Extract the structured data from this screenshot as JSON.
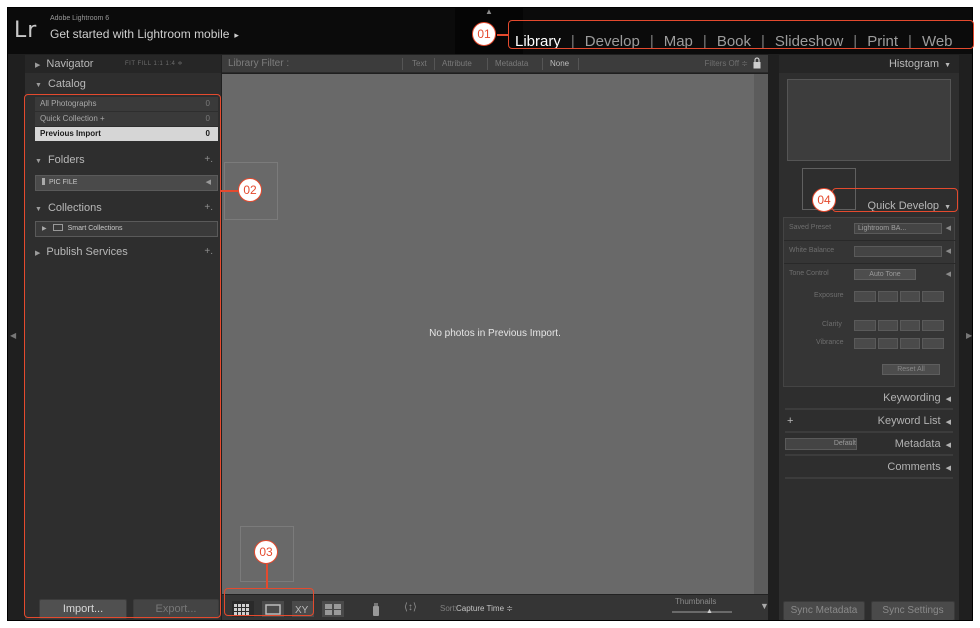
{
  "brand": {
    "logo": "Lr",
    "product": "Adobe Lightroom 6",
    "link": "Get started with Lightroom mobile",
    "link_arrow": "▸"
  },
  "modules": [
    "Library",
    "Develop",
    "Map",
    "Book",
    "Slideshow",
    "Print",
    "Web"
  ],
  "active_module": "Library",
  "left_panel": {
    "navigator": {
      "title": "Navigator",
      "options": "FIT   FILL   1:1   1:4 ≑"
    },
    "catalog": {
      "title": "Catalog",
      "items": [
        {
          "label": "All Photographs",
          "count": "0"
        },
        {
          "label": "Quick Collection +",
          "count": "0"
        },
        {
          "label": "Previous Import",
          "count": "0"
        }
      ]
    },
    "folders": {
      "title": "Folders",
      "add": "+.",
      "items": [
        {
          "label": "PIC FILE"
        }
      ]
    },
    "collections": {
      "title": "Collections",
      "add": "+.",
      "items": [
        {
          "label": "Smart Collections"
        }
      ]
    },
    "publish": {
      "title": "Publish Services",
      "add": "+."
    },
    "import_label": "Import...",
    "export_label": "Export..."
  },
  "filter_bar": {
    "title": "Library Filter :",
    "tabs": [
      "Text",
      "Attribute",
      "Metadata",
      "None"
    ],
    "active_tab": "None",
    "filters_status": "Filters Off ≑"
  },
  "center": {
    "empty_message": "No photos in Previous Import."
  },
  "toolbar": {
    "sort_label": "Sort:",
    "sort_value": "Capture Time ≑",
    "thumbnails_label": "Thumbnails"
  },
  "right_panel": {
    "histogram": "Histogram",
    "quick_develop": {
      "title": "Quick Develop",
      "saved_preset_label": "Saved Preset",
      "saved_preset_value": "Lightroom BA...",
      "white_balance_label": "White Balance",
      "tone_control_label": "Tone Control",
      "auto_tone": "Auto Tone",
      "exposure_label": "Exposure",
      "clarity_label": "Clarity",
      "vibrance_label": "Vibrance",
      "reset_all": "Reset All"
    },
    "keywording": "Keywording",
    "keyword_list": "Keyword List",
    "metadata": "Metadata",
    "metadata_preset": "Default",
    "comments": "Comments",
    "sync_metadata": "Sync Metadata",
    "sync_settings": "Sync Settings"
  },
  "callouts": [
    "01",
    "02",
    "03",
    "04"
  ],
  "colors": {
    "callout": "#e44a2e",
    "app_bg": "#1f1f1f",
    "grid_bg": "#696969",
    "panel_bg": "#2e2e2e"
  }
}
